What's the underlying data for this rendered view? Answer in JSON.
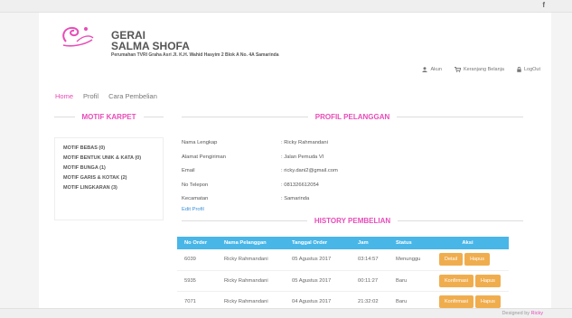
{
  "topbar": {
    "social_icon": "f"
  },
  "header": {
    "brand_line1": "GERAI",
    "brand_line2": "SALMA SHOFA",
    "address": "Perumahan TVRI Graha Asri Jl. K.H. Wahid Hasyim 2 Blok A No. 4A Samarinda"
  },
  "usernav": {
    "account": "Akun",
    "cart": "Keranjang Belanja",
    "logout": "LogOut"
  },
  "mainnav": {
    "home": "Home",
    "profile": "Profil",
    "how_to_buy": "Cara Pembelian"
  },
  "sidebar": {
    "title": "MOTIF KARPET",
    "items": [
      "MOTIF BEBAS (0)",
      "MOTIF BENTUK UNIK & KATA (0)",
      "MOTIF BUNGA (1)",
      "MOTIF GARIS & KOTAK (2)",
      "MOTIF LINGKARAN (3)"
    ]
  },
  "profile": {
    "title": "PROFIL PELANGGAN",
    "rows": [
      {
        "label": "Nama Lengkap",
        "value": ": Ricky Rahmandani"
      },
      {
        "label": "Alamat Pengiriman",
        "value": ": Jalan Pemuda VI"
      },
      {
        "label": "Email",
        "value": ": ricky.dani2@gmail.com"
      },
      {
        "label": "No Telepon",
        "value": ": 081326612054"
      },
      {
        "label": "Kecamatan",
        "value": ": Samarinda"
      }
    ],
    "edit_label": "Edit Profil"
  },
  "history": {
    "title": "HISTORY PEMBELIAN",
    "headers": [
      "No Order",
      "Nama Pelanggan",
      "Tanggal Order",
      "Jam",
      "Status",
      "Aksi"
    ],
    "rows": [
      {
        "order": "6039",
        "name": "Ricky Rahmandani",
        "date": "05 Agustus 2017",
        "time": "03:14:57",
        "status": "Menunggu",
        "action1": "Detail",
        "action2": "Hapus"
      },
      {
        "order": "5935",
        "name": "Ricky Rahmandani",
        "date": "05 Agustus 2017",
        "time": "00:11:27",
        "status": "Baru",
        "action1": "Konfirmasi",
        "action2": "Hapus"
      },
      {
        "order": "7071",
        "name": "Ricky Rahmandani",
        "date": "04 Agustus 2017",
        "time": "21:32:02",
        "status": "Baru",
        "action1": "Konfirmasi",
        "action2": "Hapus"
      }
    ]
  },
  "footer": {
    "designed_by": "Designed by",
    "author": "Ricky"
  },
  "colors": {
    "accent": "#e84cb8",
    "table_header": "#49b6e8",
    "button": "#f0ad4e"
  }
}
